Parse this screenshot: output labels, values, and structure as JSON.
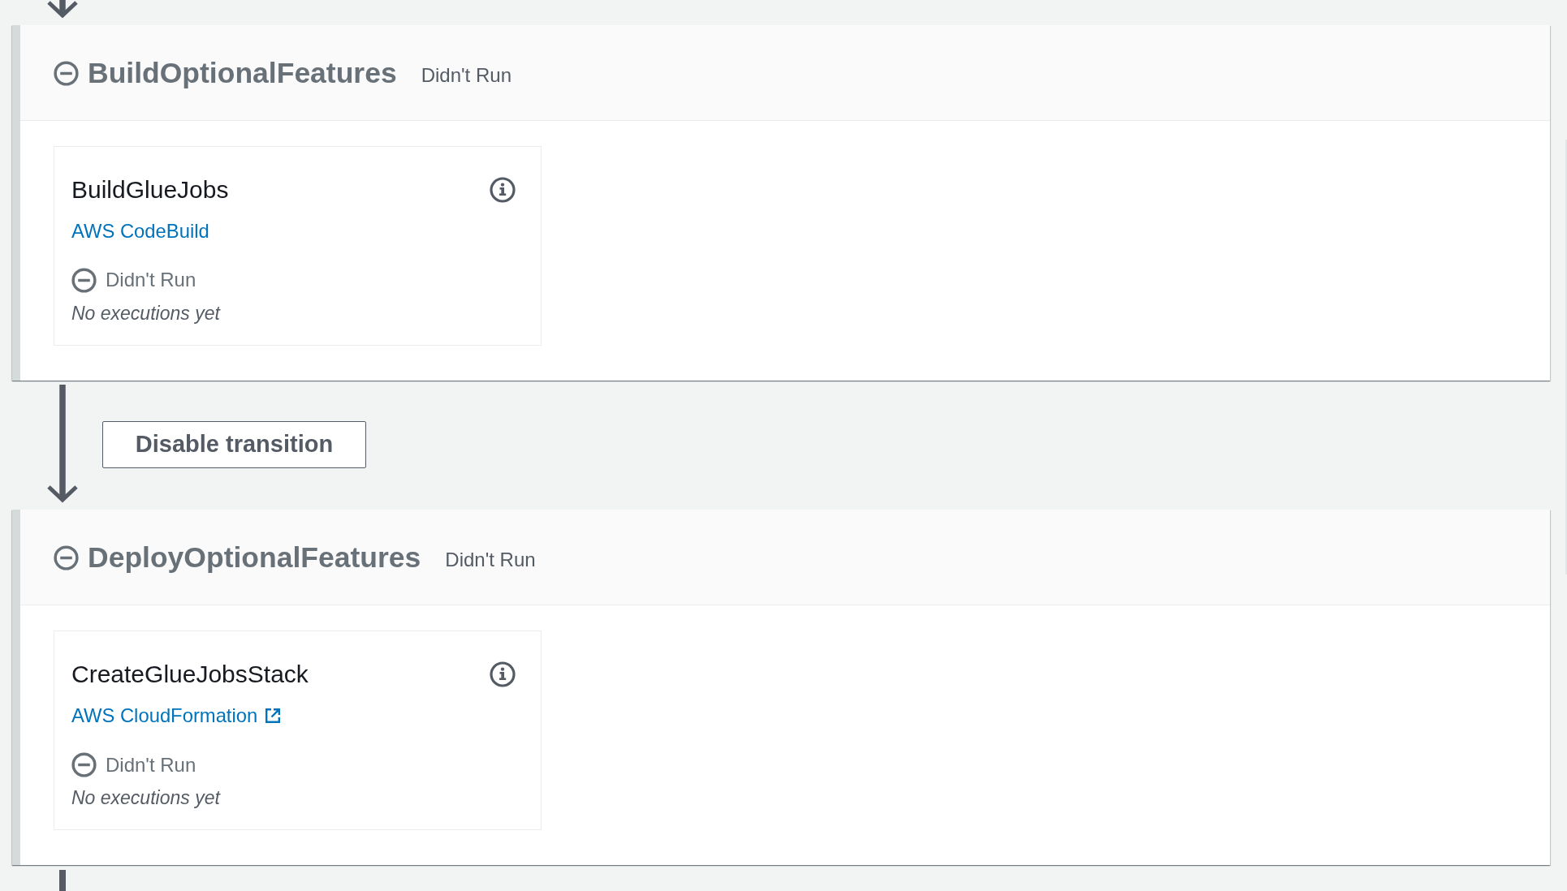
{
  "stages": [
    {
      "name": "BuildOptionalFeatures",
      "status": {
        "kind": "didnt_run",
        "label": "Didn't Run"
      },
      "actions": [
        {
          "name": "BuildGlueJobs",
          "provider": {
            "label": "AWS CodeBuild",
            "external": false
          },
          "status": {
            "kind": "didnt_run",
            "label": "Didn't Run"
          },
          "last_execution": "No executions yet"
        }
      ],
      "transition": {
        "button": "Disable transition"
      }
    },
    {
      "name": "DeployOptionalFeatures",
      "status": {
        "kind": "didnt_run",
        "label": "Didn't Run"
      },
      "actions": [
        {
          "name": "CreateGlueJobsStack",
          "provider": {
            "label": "AWS CloudFormation",
            "external": true
          },
          "status": {
            "kind": "didnt_run",
            "label": "Didn't Run"
          },
          "last_execution": "No executions yet"
        }
      ]
    }
  ]
}
